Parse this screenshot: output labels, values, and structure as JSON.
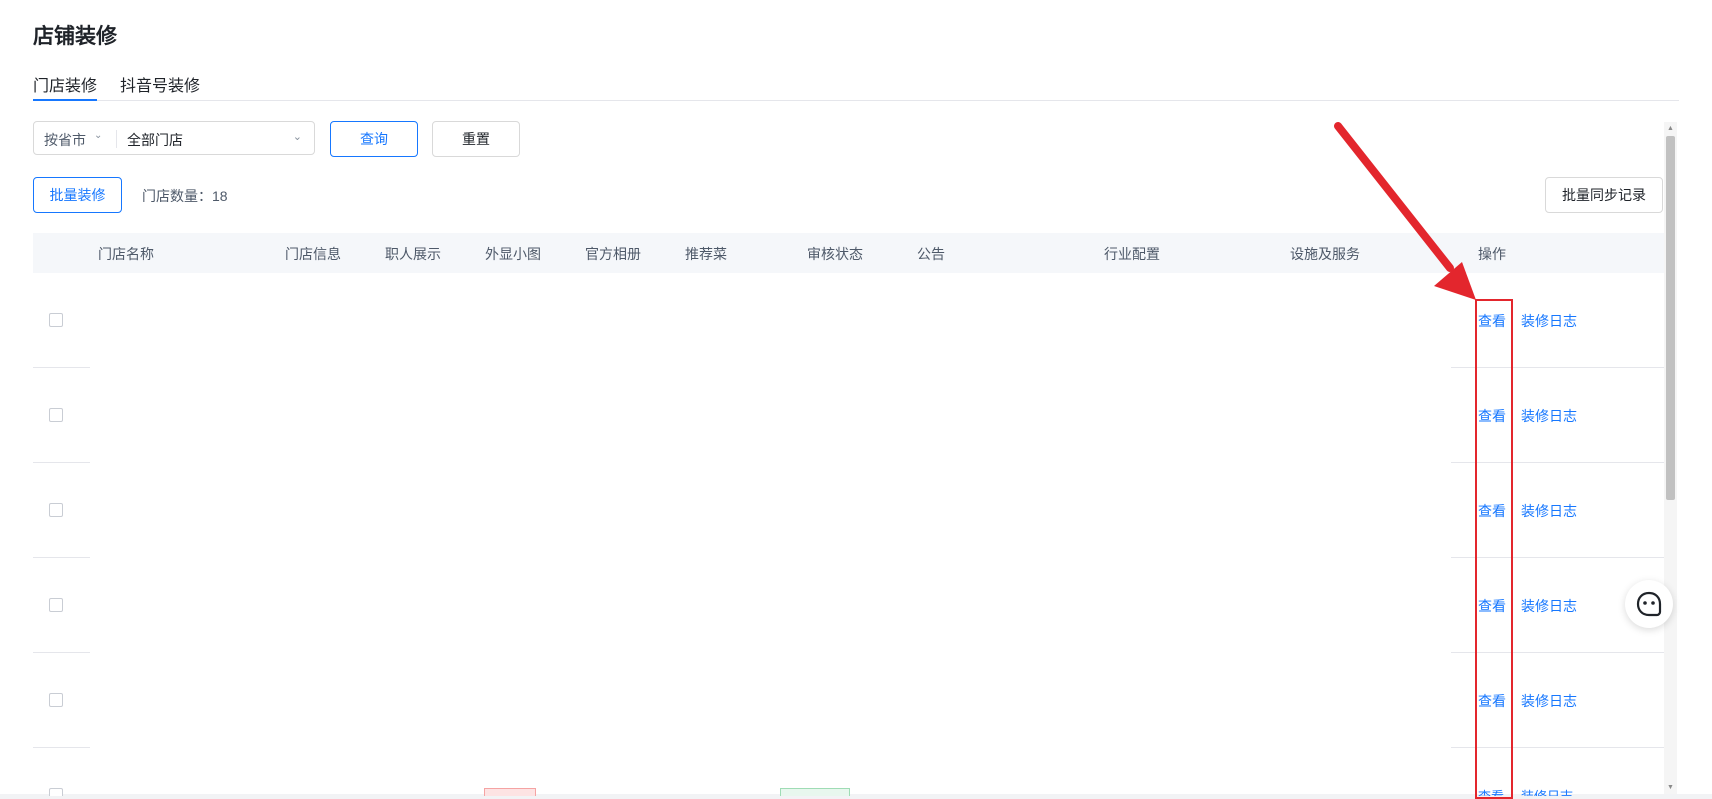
{
  "page": {
    "title": "店铺装修"
  },
  "tabs": [
    {
      "label": "门店装修",
      "active": true
    },
    {
      "label": "抖音号装修",
      "active": false
    }
  ],
  "filter": {
    "region_value": "按省市",
    "store_value": "全部门店",
    "query_label": "查询",
    "reset_label": "重置"
  },
  "toolbar": {
    "batch_decorate_label": "批量装修",
    "store_count_text": "门店数量：18",
    "batch_sync_label": "批量同步记录"
  },
  "table": {
    "columns": [
      "门店名称",
      "门店信息",
      "职人展示",
      "外显小图",
      "官方相册",
      "推荐菜",
      "审核状态",
      "公告",
      "行业配置",
      "设施及服务",
      "操作"
    ],
    "rows": [
      {
        "view_label": "查看",
        "log_label": "装修日志"
      },
      {
        "view_label": "查看",
        "log_label": "装修日志"
      },
      {
        "view_label": "查看",
        "log_label": "装修日志"
      },
      {
        "view_label": "查看",
        "log_label": "装修日志"
      },
      {
        "view_label": "查看",
        "log_label": "装修日志"
      }
    ],
    "partial_row": {
      "view_label": "查看",
      "log_label": "装修日志"
    }
  },
  "colors": {
    "accent": "#1677ff",
    "annotation": "#e3262d"
  },
  "icons": {
    "chat": "chat-bot-icon",
    "chevron": "chevron-down-icon"
  }
}
